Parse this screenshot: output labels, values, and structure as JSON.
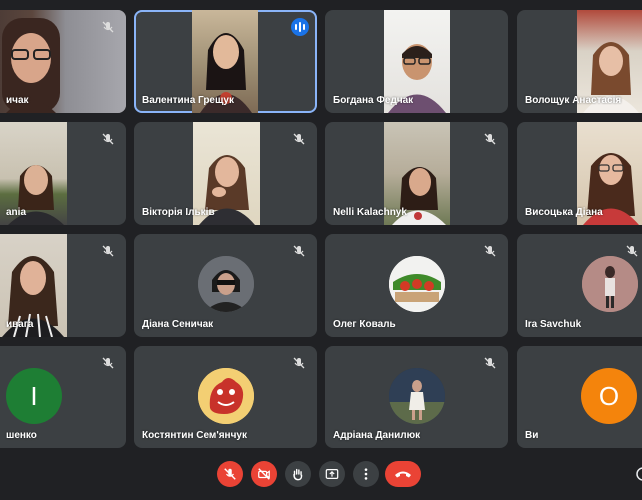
{
  "participants": [
    {
      "name": "ичак"
    },
    {
      "name": "Валентина Грещук"
    },
    {
      "name": "Богдана Федчак"
    },
    {
      "name": "Волощук Анастасія"
    },
    {
      "name": "ania"
    },
    {
      "name": "Вікторія Ільків"
    },
    {
      "name": "Nelli Kalachnyk"
    },
    {
      "name": "Висоцька Діана"
    },
    {
      "name": "ивага"
    },
    {
      "name": "Діана Сеничак"
    },
    {
      "name": "Олег Коваль"
    },
    {
      "name": "Ira Savchuk"
    },
    {
      "name": "шенко",
      "initial": "I"
    },
    {
      "name": "Костянтин Сем'янчук"
    },
    {
      "name": "Адріана Данилюк"
    },
    {
      "name": "Ви",
      "initial": "О"
    }
  ],
  "colors": {
    "background": "#202124",
    "tile": "#3c4043",
    "active_outline": "#8ab4f8",
    "speaking": "#1a73e8",
    "red": "#ea4335",
    "avatar_green": "#1e7e34",
    "avatar_orange": "#f4840c"
  },
  "controls": {
    "icons": [
      "mic-off-icon",
      "camera-off-icon",
      "raise-hand-icon",
      "present-screen-icon",
      "more-options-icon",
      "hang-up-icon"
    ]
  }
}
